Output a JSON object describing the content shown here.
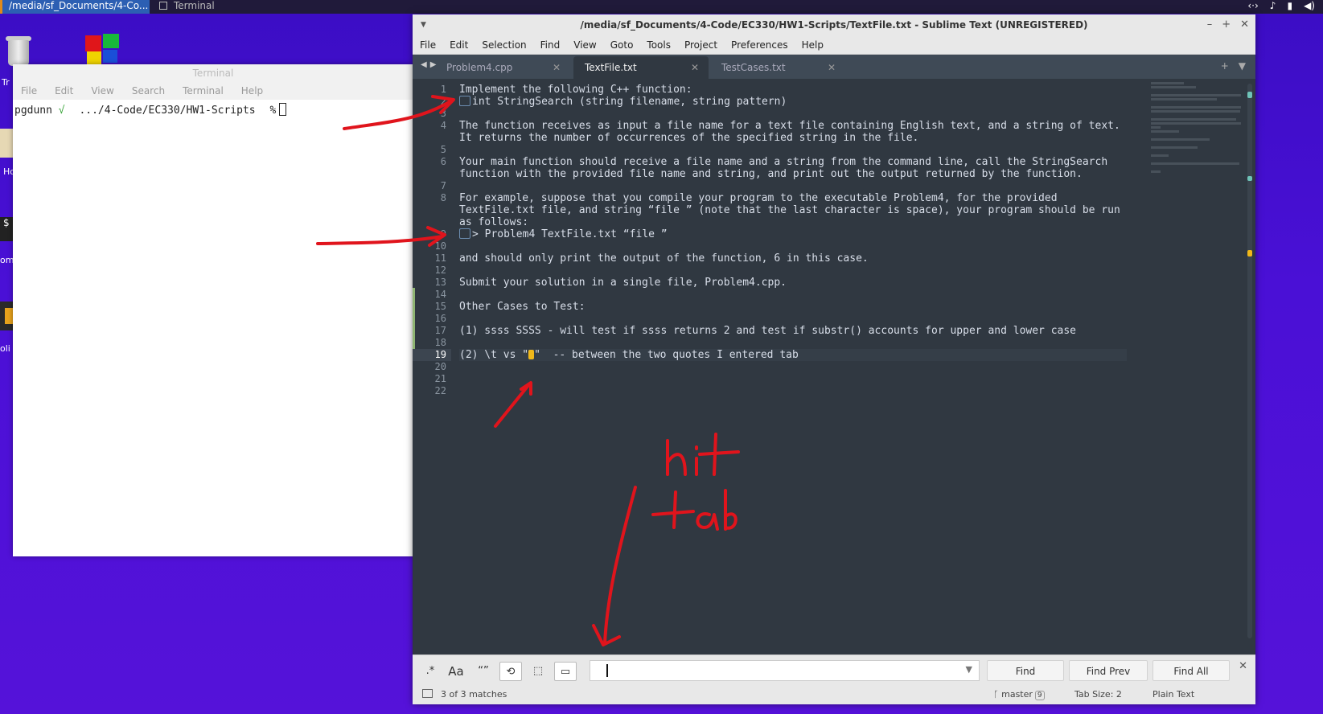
{
  "taskbar": {
    "active_task": "/media/sf_Documents/4-Co...",
    "terminal_task": "Terminal",
    "tray_icons": [
      "network-icon",
      "bell-icon",
      "battery-icon",
      "volume-icon"
    ]
  },
  "desktop": {
    "trash_label": "Tr",
    "home_label": "Ho",
    "term_frag": "$",
    "om_label": "om",
    "oli_label": "oli"
  },
  "terminal": {
    "title": "Terminal",
    "menu": [
      "File",
      "Edit",
      "View",
      "Search",
      "Terminal",
      "Help"
    ],
    "prompt_user": "pgdunn",
    "prompt_check": "√",
    "prompt_path": ".../4-Code/EC330/HW1-Scripts",
    "prompt_symbol": "%"
  },
  "sublime": {
    "title": "/media/sf_Documents/4-Code/EC330/HW1-Scripts/TextFile.txt - Sublime Text (UNREGISTERED)",
    "menu": [
      "File",
      "Edit",
      "Selection",
      "Find",
      "View",
      "Goto",
      "Tools",
      "Project",
      "Preferences",
      "Help"
    ],
    "tabs": [
      "Problem4.cpp",
      "TextFile.txt",
      "TestCases.txt"
    ],
    "active_tab": "TextFile.txt",
    "current_line": 19,
    "lines": [
      {
        "n": "1",
        "t": "Implement the following C++ function:"
      },
      {
        "n": "2",
        "t": "int StringSearch (string filename, string pattern)",
        "tab": true
      },
      {
        "n": "3",
        "t": ""
      },
      {
        "n": "4",
        "t": "The function receives as input a file name for a text file containing English text, and a string of text."
      },
      {
        "n": "",
        "t": "It returns the number of occurrences of the specified string in the file."
      },
      {
        "n": "5",
        "t": ""
      },
      {
        "n": "6",
        "t": "Your main function should receive a file name and a string from the command line, call the StringSearch"
      },
      {
        "n": "",
        "t": "function with the provided file name and string, and print out the output returned by the function."
      },
      {
        "n": "7",
        "t": ""
      },
      {
        "n": "8",
        "t": "For example, suppose that you compile your program to the executable Problem4, for the provided"
      },
      {
        "n": "",
        "t": "TextFile.txt file, and string “file ” (note that the last character is space), your program should be run"
      },
      {
        "n": "",
        "t": "as follows:"
      },
      {
        "n": "9",
        "t": "> Problem4 TextFile.txt “file ”",
        "tab": true
      },
      {
        "n": "10",
        "t": ""
      },
      {
        "n": "11",
        "t": "and should only print the output of the function, 6 in this case."
      },
      {
        "n": "12",
        "t": ""
      },
      {
        "n": "13",
        "t": "Submit your solution in a single file, Problem4.cpp."
      },
      {
        "n": "14",
        "t": ""
      },
      {
        "n": "15",
        "t": "Other Cases to Test:"
      },
      {
        "n": "16",
        "t": ""
      },
      {
        "n": "17",
        "t": "(1) ssss SSSS - will test if ssss returns 2 and test if substr() accounts for upper and lower case"
      },
      {
        "n": "18",
        "t": ""
      },
      {
        "n": "19",
        "t": "(2) \\t vs \"",
        "after": "\"  -- between the two quotes I entered tab",
        "mark": true
      },
      {
        "n": "20",
        "t": ""
      },
      {
        "n": "21",
        "t": ""
      },
      {
        "n": "22",
        "t": ""
      }
    ],
    "find": {
      "regex_label": ".*",
      "case_label": "Aa",
      "word_label": "“”",
      "wrap_label": "⟲",
      "insel_label": "⬚",
      "highlight_label": "▭",
      "input_value": "",
      "find_label": "Find",
      "find_prev_label": "Find Prev",
      "find_all_label": "Find All"
    },
    "status": {
      "matches": "3 of 3 matches",
      "branch": "master",
      "branch_count": "9",
      "tab_size": "Tab Size: 2",
      "syntax": "Plain Text"
    }
  },
  "annotations": {
    "handwritten_text": "hit tab",
    "color": "#e0141c"
  }
}
